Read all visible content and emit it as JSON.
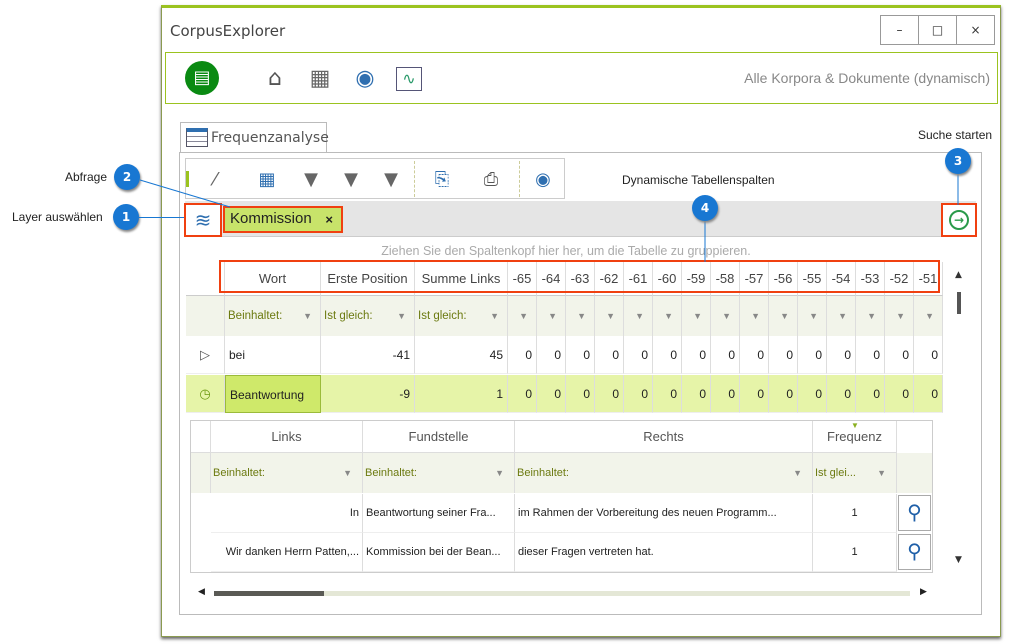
{
  "window": {
    "title": "CorpusExplorer",
    "minimize": "–",
    "maximize": "□",
    "close": "×"
  },
  "topbar": {
    "context_label": "Alle Korpora & Dokumente (dynamisch)",
    "icons": [
      "corpus-green-icon",
      "home-icon",
      "cabinet-icon",
      "camera-icon",
      "monitor-pulse-icon"
    ]
  },
  "tab": {
    "label": "Frequenzanalyse"
  },
  "toolbar": {
    "icons": [
      "magic-wand-icon",
      "calculator-icon",
      "filter-clipboard-icon",
      "filter-wrench-icon",
      "filter-barcode-icon",
      "export-document-icon",
      "print-icon",
      "snapshot-add-icon"
    ]
  },
  "query": {
    "chip_label": "Kommission",
    "chip_remove": "×"
  },
  "grid": {
    "group_hint": "Ziehen Sie den Spaltenkopf hier her, um die Tabelle zu gruppieren.",
    "columns": [
      "Wort",
      "Erste Position",
      "Summe Links",
      "-65",
      "-64",
      "-63",
      "-62",
      "-61",
      "-60",
      "-59",
      "-58",
      "-57",
      "-56",
      "-55",
      "-54",
      "-53",
      "-52",
      "-51"
    ],
    "filters": [
      "Beinhaltet:",
      "Ist gleich:",
      "Ist gleich:"
    ],
    "rows": [
      {
        "cells": [
          "bei",
          "-41",
          "45",
          "0",
          "0",
          "0",
          "0",
          "0",
          "0",
          "0",
          "0",
          "0",
          "0",
          "0",
          "0",
          "0",
          "0",
          "0"
        ],
        "expanded": false
      },
      {
        "cells": [
          "Beantwortung",
          "-9",
          "1",
          "0",
          "0",
          "0",
          "0",
          "0",
          "0",
          "0",
          "0",
          "0",
          "0",
          "0",
          "0",
          "0",
          "0",
          "0"
        ],
        "expanded": true
      }
    ]
  },
  "detail": {
    "columns": [
      "Links",
      "Fundstelle",
      "Rechts",
      "Frequenz"
    ],
    "filters": [
      "Beinhaltet:",
      "Beinhaltet:",
      "Beinhaltet:",
      "Ist glei..."
    ],
    "rows": [
      [
        "In",
        "Beantwortung seiner Fra...",
        "im Rahmen der Vorbereitung des neuen Programm...",
        "1"
      ],
      [
        "Wir danken Herrn Patten,...",
        "Kommission bei der Bean...",
        "dieser Fragen vertreten hat.",
        "1"
      ]
    ]
  },
  "annotations": [
    {
      "num": "1",
      "label": "Layer auswählen"
    },
    {
      "num": "2",
      "label": "Abfrage"
    },
    {
      "num": "3",
      "label": "Suche starten"
    },
    {
      "num": "4",
      "label": "Dynamische Tabellenspalten"
    }
  ],
  "colors": {
    "accent": "#9bc31f",
    "highlight": "#d0ec6a",
    "annotation": "#1877d2",
    "callout_border": "#f04010"
  }
}
